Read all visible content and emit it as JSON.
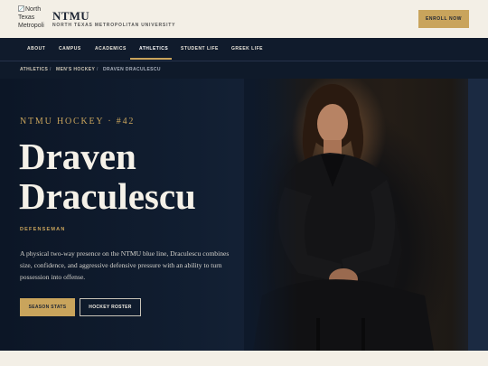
{
  "header": {
    "logo_alt": "North Texas Metropoli",
    "brand_name": "NTMU",
    "brand_subtitle": "NORTH TEXAS METROPOLITAN UNIVERSITY",
    "cta_label": "ENROLL NOW"
  },
  "nav": {
    "items": [
      {
        "label": "ABOUT"
      },
      {
        "label": "CAMPUS"
      },
      {
        "label": "ACADEMICS"
      },
      {
        "label": "ATHLETICS",
        "active": true
      },
      {
        "label": "STUDENT LIFE"
      },
      {
        "label": "GREEK LIFE"
      }
    ]
  },
  "breadcrumb": {
    "items": [
      "ATHLETICS",
      "MEN'S HOCKEY",
      "DRAVEN DRACULESCU"
    ],
    "separator": "/"
  },
  "hero": {
    "eyebrow": "NTMU HOCKEY · #42",
    "name_line1": "Draven",
    "name_line2": "Draculescu",
    "position": "DEFENSEMAN",
    "bio": "A physical two-way presence on the NTMU blue line, Draculescu combines size, confidence, and aggressive defensive pressure with an ability to turn possession into offense.",
    "primary_button": "SEASON STATS",
    "secondary_button": "HOCKEY ROSTER"
  },
  "colors": {
    "accent_gold": "#c9a45c",
    "navy": "#101b2c",
    "cream": "#f3efe6"
  }
}
